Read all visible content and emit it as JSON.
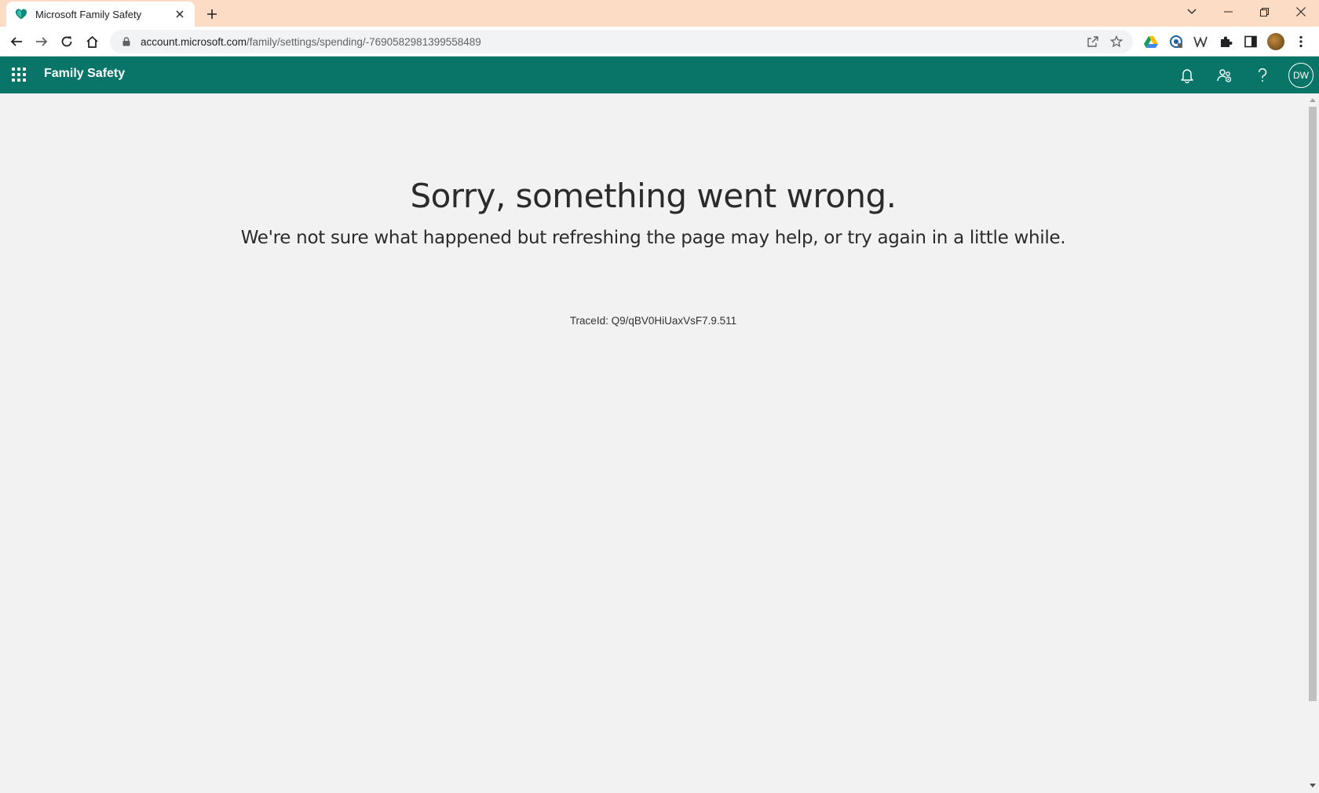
{
  "browser": {
    "tab": {
      "title": "Microsoft Family Safety",
      "favicon": "heart-shield-icon"
    },
    "address_bar": {
      "host": "account.microsoft.com",
      "path": "/family/settings/spending/-7690582981399558489"
    }
  },
  "app": {
    "title": "Family Safety",
    "brand_color": "#087568",
    "user_initials": "DW"
  },
  "error": {
    "title": "Sorry, something went wrong.",
    "message": "We're not sure what happened but refreshing the page may help, or try again in a little while.",
    "trace_label": "TraceId: Q9/qBV0HiUaxVsF7.9.511"
  }
}
